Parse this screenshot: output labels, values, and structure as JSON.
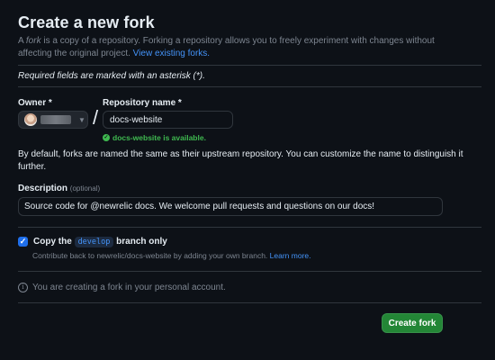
{
  "header": {
    "title": "Create a new fork"
  },
  "intro": {
    "prefix": "A ",
    "fork_word": "fork",
    "text": " is a copy of a repository. Forking a repository allows you to freely experiment with changes without affecting the original project. ",
    "link": "View existing forks."
  },
  "required_note": "Required fields are marked with an asterisk (*).",
  "owner": {
    "label": "Owner *",
    "chevron_icon": "chevron-down-icon"
  },
  "slash": "/",
  "repository": {
    "label": "Repository name *",
    "value": "docs-website",
    "availability": "docs-website is available.",
    "availability_color": "#3fb950"
  },
  "default_note": "By default, forks are named the same as their upstream repository. You can customize the name to distinguish it further.",
  "description": {
    "label": "Description",
    "optional": "(optional)",
    "value": "Source code for @newrelic docs. We welcome pull requests and questions on our docs!"
  },
  "copy_branch": {
    "checked": true,
    "prefix": "Copy the ",
    "branch": "develop",
    "suffix": " branch only",
    "help_text": "Contribute back to newrelic/docs-website by adding your own branch. ",
    "help_link": "Learn more."
  },
  "info": {
    "text": "You are creating a fork in your personal account."
  },
  "actions": {
    "create_fork": "Create fork",
    "create_fork_color": "#238636"
  },
  "colors": {
    "background": "#0d1117",
    "link": "#4493f8",
    "border": "#30363d"
  }
}
